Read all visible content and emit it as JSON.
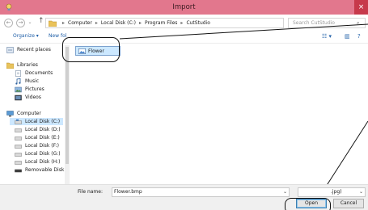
{
  "window": {
    "title": "Import",
    "close_glyph": "×",
    "titlebar_color": "#e2778d",
    "icons": {
      "app": "app-icon",
      "close": "close-icon"
    }
  },
  "address_bar": {
    "back_glyph": "←",
    "forward_glyph": "→",
    "up_glyph": "↑",
    "separator": "▸",
    "breadcrumbs": [
      "Computer",
      "Local Disk (C:)",
      "Program Files",
      "CutStudio"
    ],
    "dropdown_glyph": "⌄",
    "refresh_glyph": "↻",
    "search_placeholder": "Search CutStudio",
    "search_glyph": "⌕"
  },
  "toolbar": {
    "organize_label": "Organize ▾",
    "new_folder_label": "New fol",
    "view_glyph": "☷ ▾",
    "pane_glyph": "▥",
    "help_glyph": "?"
  },
  "nav_pane": {
    "items": [
      {
        "label": "Recent places",
        "icon": "recent-places-icon"
      },
      {
        "label": "Libraries",
        "icon": "library-icon"
      },
      {
        "label": "Documents",
        "icon": "documents-icon"
      },
      {
        "label": "Music",
        "icon": "music-icon"
      },
      {
        "label": "Pictures",
        "icon": "pictures-icon"
      },
      {
        "label": "Videos",
        "icon": "videos-icon"
      },
      {
        "label": "Computer",
        "icon": "computer-icon"
      },
      {
        "label": "Local Disk (C:)",
        "icon": "drive-icon"
      },
      {
        "label": "Local Disk (D:)",
        "icon": "drive-icon"
      },
      {
        "label": "Local Disk (E:)",
        "icon": "drive-icon"
      },
      {
        "label": "Local Disk (F:)",
        "icon": "drive-icon"
      },
      {
        "label": "Local Disk (G:)",
        "icon": "drive-icon"
      },
      {
        "label": "Local Disk (H:)",
        "icon": "drive-icon"
      },
      {
        "label": "Removable Disk (",
        "icon": "removable-disk-icon"
      }
    ],
    "selected_item": "Local Disk (C:)"
  },
  "content": {
    "files": [
      {
        "name": "Flower",
        "icon": "bitmap-file-icon",
        "selected": true
      }
    ]
  },
  "footer": {
    "file_name_label": "File name:",
    "file_name_value": "Flower.bmp",
    "file_type_value": ".jpg)",
    "dropdown_glyph": "⌄",
    "open_label": "Open",
    "cancel_label": "Cancel"
  }
}
